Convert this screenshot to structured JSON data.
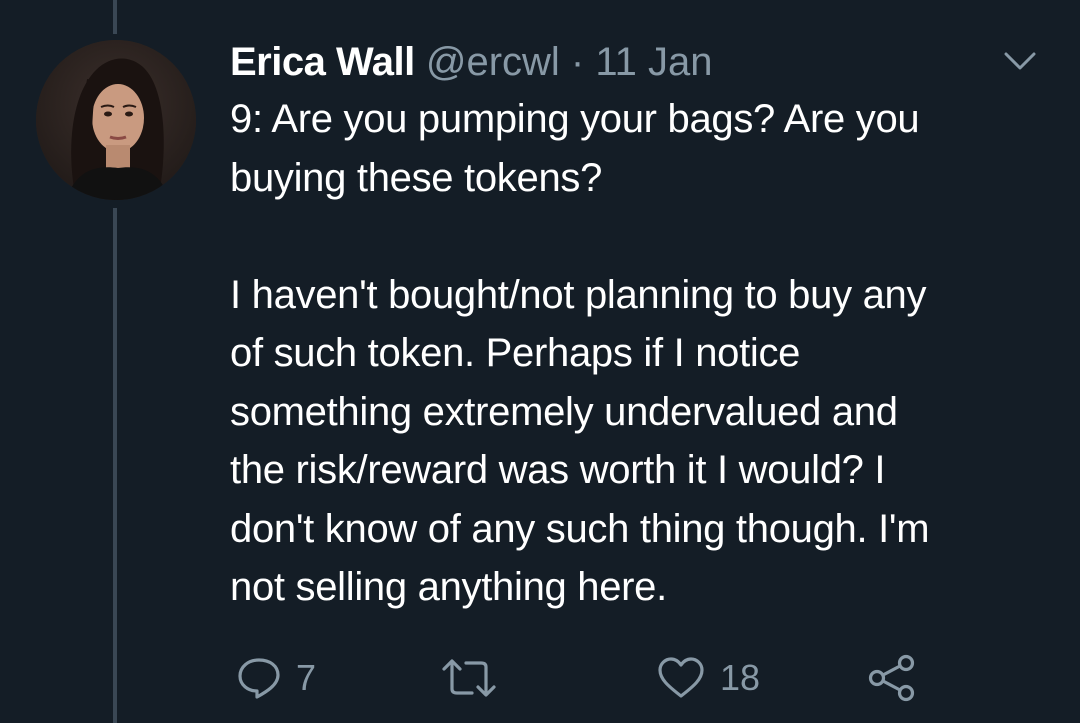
{
  "tweet": {
    "author_name": "Erica Wall",
    "handle": "@ercwl",
    "separator": "·",
    "date": "11 Jan",
    "body_lines": [
      "9: Are you pumping your bags? Are you",
      "buying these tokens?",
      "",
      "I haven't bought/not planning to buy any",
      "of such token. Perhaps if I notice",
      "something extremely undervalued and",
      "the risk/reward was worth it I would? I",
      "don't know of any such thing though. I'm",
      "not selling anything here."
    ]
  },
  "actions": {
    "reply_count": "7",
    "retweet_count": "",
    "like_count": "18"
  },
  "icons": {
    "reply": "reply-icon",
    "retweet": "retweet-icon",
    "like": "heart-icon",
    "share": "share-icon",
    "menu": "chevron-down-icon"
  },
  "colors": {
    "background": "#141d26",
    "text": "#ffffff",
    "secondary": "#8899a6",
    "thread_line": "#3a4754"
  }
}
